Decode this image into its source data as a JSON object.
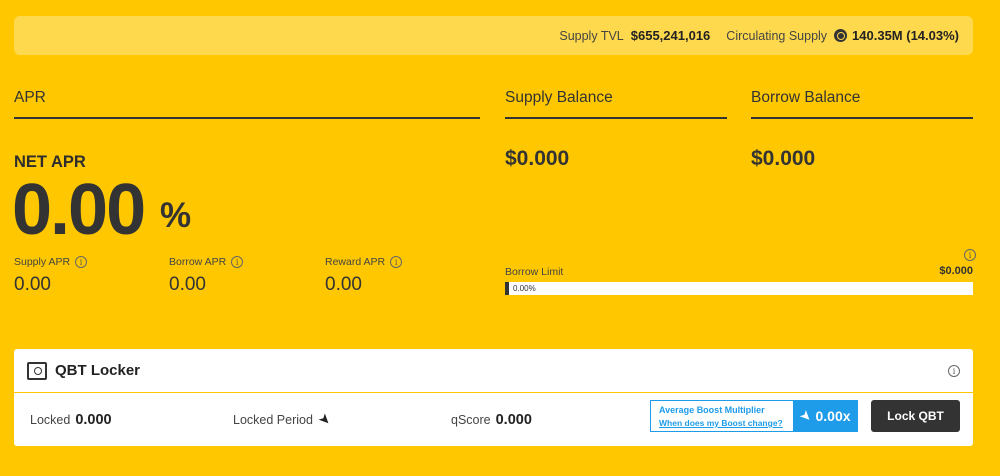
{
  "topbar": {
    "supply_tvl_label": "Supply TVL",
    "supply_tvl_value": "$655,241,016",
    "circ_supply_label": "Circulating Supply",
    "circ_supply_value": "140.35M (14.03%)"
  },
  "apr": {
    "header": "APR",
    "net_label": "NET APR",
    "net_value": "0.00",
    "net_unit": "%",
    "supply_label": "Supply APR",
    "supply_value": "0.00",
    "borrow_label": "Borrow APR",
    "borrow_value": "0.00",
    "reward_label": "Reward APR",
    "reward_value": "0.00"
  },
  "supply_balance": {
    "header": "Supply Balance",
    "value": "$0.000"
  },
  "borrow_balance": {
    "header": "Borrow Balance",
    "value": "$0.000"
  },
  "borrow_limit": {
    "label": "Borrow Limit",
    "value": "$0.000",
    "percent_text": "0.00%",
    "fraction": 0.0
  },
  "locker": {
    "title": "QBT Locker",
    "locked_label": "Locked",
    "locked_value": "0.000",
    "period_label": "Locked Period",
    "qscore_label": "qScore",
    "qscore_value": "0.000",
    "boost_title": "Average Boost Multiplier",
    "boost_link": "When does my Boost change?",
    "boost_value": "0.00x",
    "lock_button": "Lock QBT"
  },
  "colors": {
    "background": "#FFC700",
    "accent_blue": "#1E9BE9",
    "dark": "#333333"
  },
  "icons": [
    "coin-icon",
    "info-icon",
    "safe-icon",
    "rocket-icon"
  ]
}
